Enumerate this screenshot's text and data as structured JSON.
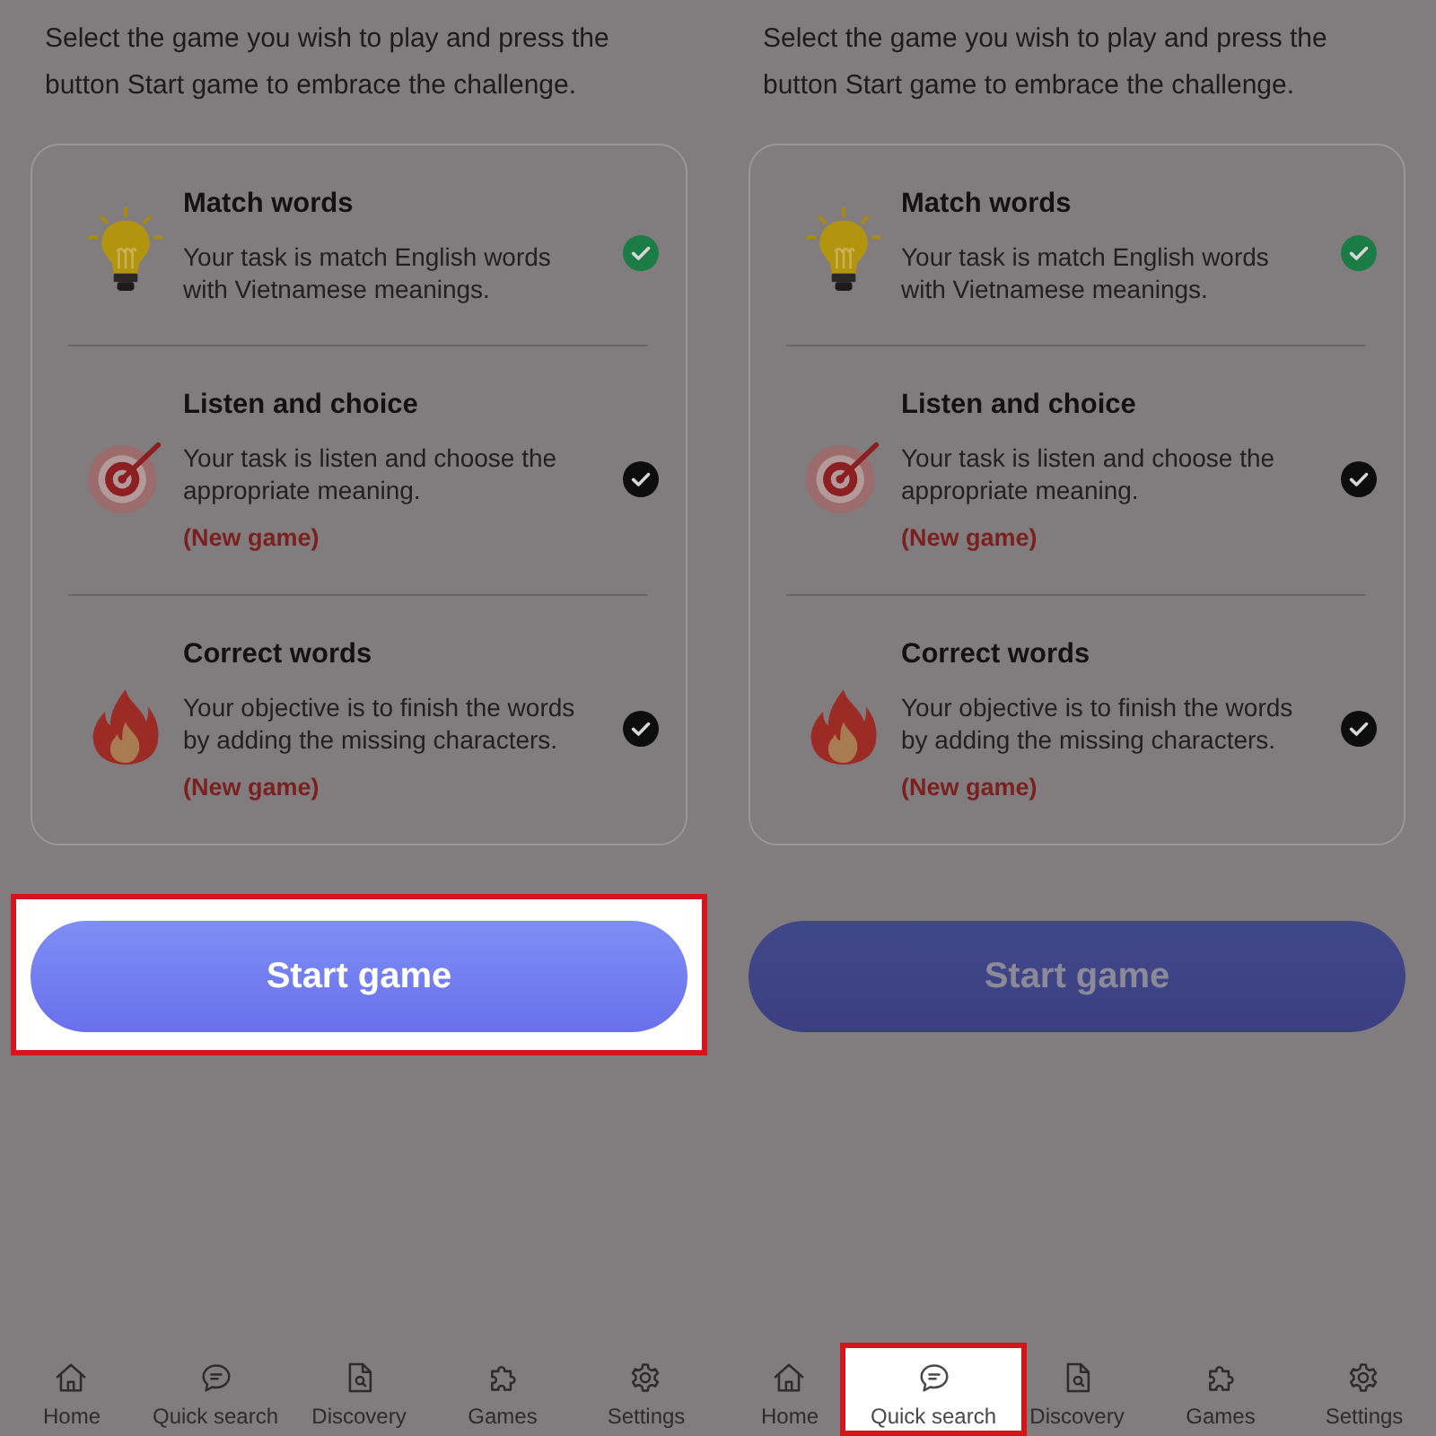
{
  "panels": [
    {
      "intro": "Select the game you wish to play and press the button Start game to embrace the challenge.",
      "games": [
        {
          "title": "Match words",
          "description": "Your task is match English words with Vietnamese meanings.",
          "selected": true
        },
        {
          "title": "Listen and choice",
          "description": "Your task is listen and choose the appropriate meaning.",
          "tag": "(New game)",
          "selected": false
        },
        {
          "title": "Correct words",
          "description": "Your objective is to finish the words by adding the missing characters.",
          "tag": "(New game)",
          "selected": false
        }
      ],
      "start_button": {
        "label": "Start game",
        "highlighted": true
      },
      "nav": [
        {
          "label": "Home",
          "highlighted": false
        },
        {
          "label": "Quick search",
          "highlighted": false
        },
        {
          "label": "Discovery",
          "highlighted": false
        },
        {
          "label": "Games",
          "highlighted": false
        },
        {
          "label": "Settings",
          "highlighted": false
        }
      ]
    },
    {
      "intro": "Select the game you wish to play and press the button Start game to embrace the challenge.",
      "games": [
        {
          "title": "Match words",
          "description": "Your task is match English words with Vietnamese meanings.",
          "selected": true
        },
        {
          "title": "Listen and choice",
          "description": "Your task is listen and choose the appropriate meaning.",
          "tag": "(New game)",
          "selected": false
        },
        {
          "title": "Correct words",
          "description": "Your objective is to finish the words by adding the missing characters.",
          "tag": "(New game)",
          "selected": false
        }
      ],
      "start_button": {
        "label": "Start game",
        "highlighted": false
      },
      "nav": [
        {
          "label": "Home",
          "highlighted": false
        },
        {
          "label": "Quick search",
          "highlighted": true
        },
        {
          "label": "Discovery",
          "highlighted": false
        },
        {
          "label": "Games",
          "highlighted": false
        },
        {
          "label": "Settings",
          "highlighted": false
        }
      ]
    }
  ]
}
